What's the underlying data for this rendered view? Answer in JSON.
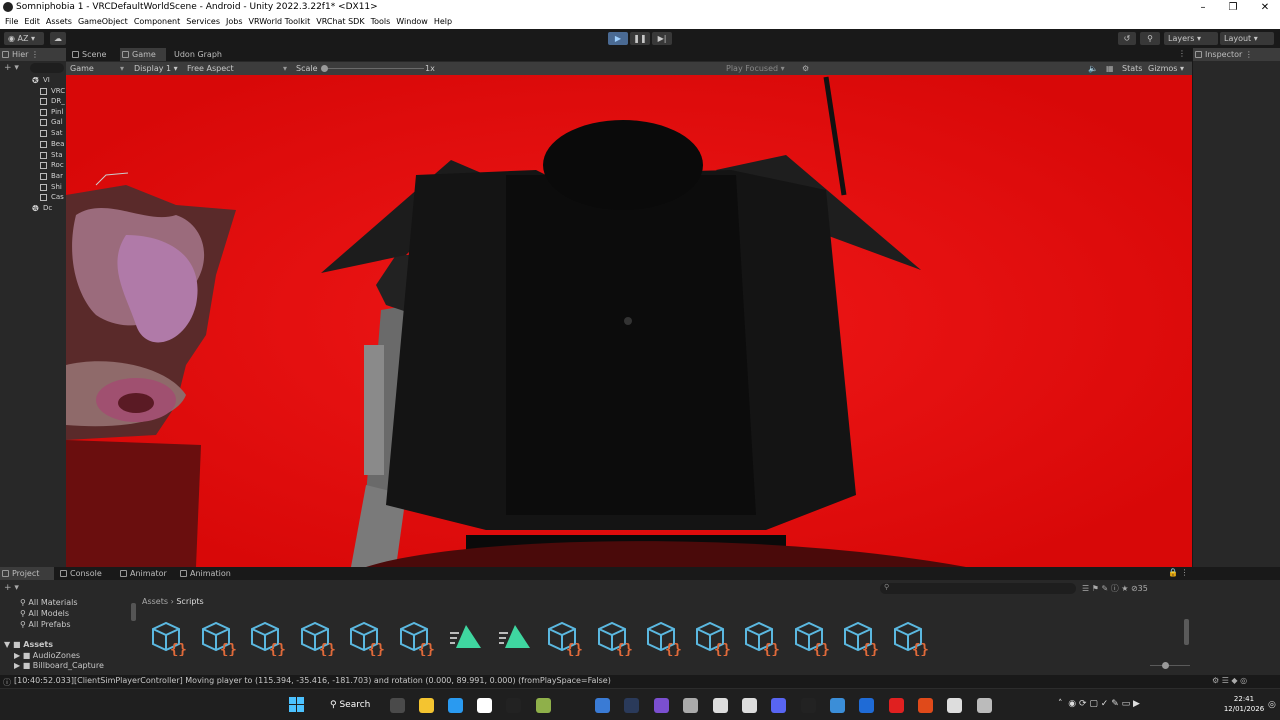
{
  "window": {
    "title": "Somniphobia 1 - VRCDefaultWorldScene - Android - Unity 2022.3.22f1* <DX11>"
  },
  "menu": [
    "File",
    "Edit",
    "Assets",
    "GameObject",
    "Component",
    "Services",
    "Jobs",
    "VRWorld Toolkit",
    "VRChat SDK",
    "Tools",
    "Window",
    "Help"
  ],
  "toolbar": {
    "account": "AZ",
    "layers": "Layers",
    "layout": "Layout"
  },
  "tabs": {
    "hierarchy": "Hier",
    "scene": "Scene",
    "game": "Game",
    "udon": "Udon Graph",
    "inspector": "Inspector"
  },
  "game_toolbar": {
    "mode": "Game",
    "display": "Display 1",
    "aspect": "Free Aspect",
    "scale_label": "Scale",
    "scale_value": "1x",
    "play_focused": "Play Focused",
    "stats": "Stats",
    "gizmos": "Gizmos"
  },
  "hierarchy": {
    "root": "VI",
    "items": [
      "VRC",
      "DR_",
      "Pinl",
      "Gal",
      "Sat",
      "Bea",
      "Sta",
      "Roc",
      "Bar",
      "Shi",
      "Cas"
    ],
    "root2": "Dc"
  },
  "bottom_tabs": {
    "project": "Project",
    "console": "Console",
    "animator": "Animator",
    "animation": "Animation"
  },
  "project": {
    "favorites": [
      "All Materials",
      "All Models",
      "All Prefabs"
    ],
    "assets_root": "Assets",
    "folders": [
      "AudioZones",
      "Billboard_Capture"
    ],
    "breadcrumb": [
      "Assets",
      "Scripts"
    ],
    "hidden_count": "35"
  },
  "status": {
    "message": "[10:40:52.033][ClientSimPlayerController] Moving player to (115.394, -35.416, -181.703) and rotation (0.000, 89.991, 0.000) (fromPlaySpace=False)"
  },
  "taskbar": {
    "search": "Search",
    "time": "22:41",
    "date": "12/01/2026"
  },
  "colors": {
    "game_bg": "#e80c0c",
    "accent": "#4a8cd6",
    "script_icon": "#5bb8e0",
    "script_brace": "#e06a3a",
    "shader_icon": "#3fd6a0"
  },
  "icons": {
    "assets": [
      "script-icon",
      "script-icon",
      "script-icon",
      "script-icon",
      "script-icon",
      "script-icon",
      "shader-icon",
      "shader-icon",
      "script-icon",
      "script-icon",
      "script-icon",
      "script-icon",
      "script-icon",
      "script-icon",
      "script-icon",
      "script-icon"
    ]
  }
}
